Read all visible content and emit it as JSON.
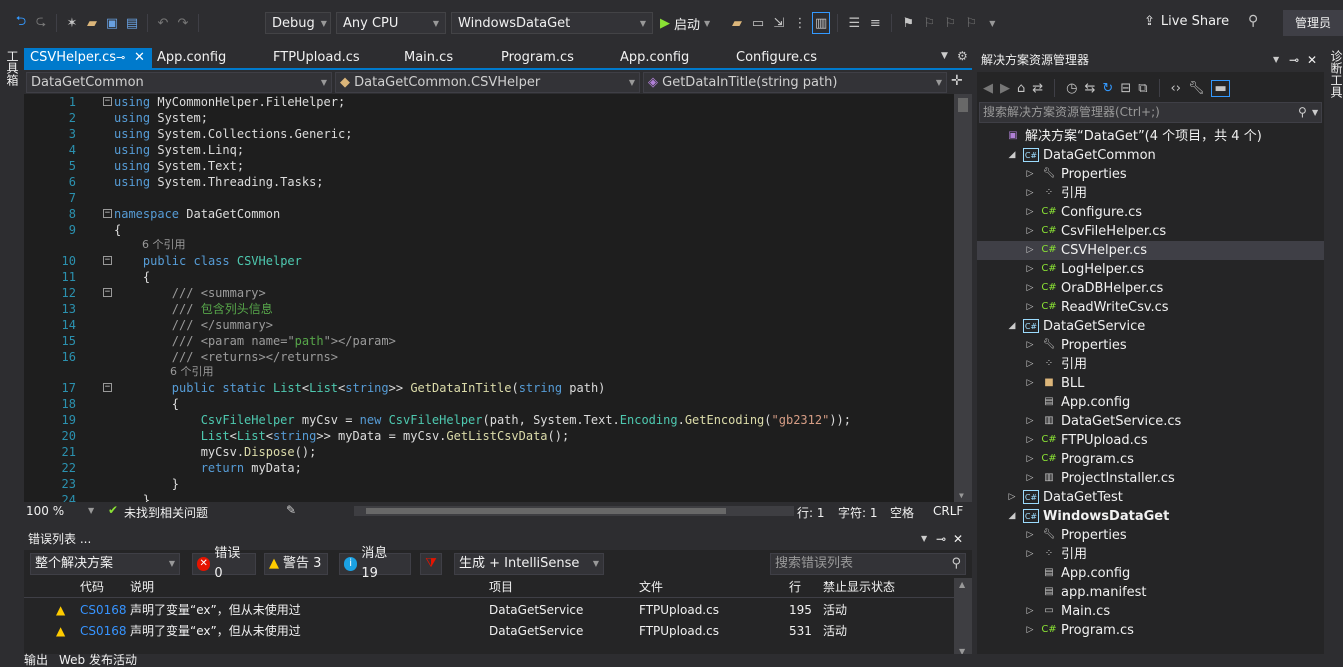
{
  "toolbar": {
    "config": "Debug",
    "platform": "Any CPU",
    "startup_project": "WindowsDataGet",
    "start_label": "启动",
    "live_share": "Live Share",
    "admin": "管理员"
  },
  "left_strip": {
    "label": "工具箱"
  },
  "right_strip": {
    "label": "诊断工具"
  },
  "doc_tabs": [
    {
      "label": "CSVHelper.cs",
      "active": true
    },
    {
      "label": "App.config"
    },
    {
      "label": "FTPUpload.cs"
    },
    {
      "label": "Main.cs"
    },
    {
      "label": "Program.cs"
    },
    {
      "label": "App.config"
    },
    {
      "label": "Configure.cs"
    }
  ],
  "nav": {
    "project": "DataGetCommon",
    "type": "DataGetCommon.CSVHelper",
    "member": "GetDataInTitle(string path)"
  },
  "code_lines": [
    {
      "n": "1",
      "code": "using MyCommonHelper.FileHelper;"
    },
    {
      "n": "2",
      "code": "using System;"
    },
    {
      "n": "3",
      "code": "using System.Collections.Generic;"
    },
    {
      "n": "4",
      "code": "using System.Linq;"
    },
    {
      "n": "5",
      "code": "using System.Text;"
    },
    {
      "n": "6",
      "code": "using System.Threading.Tasks;"
    },
    {
      "n": "7",
      "code": ""
    },
    {
      "n": "8",
      "code": "namespace DataGetCommon"
    },
    {
      "n": "9",
      "code": "{"
    },
    {
      "n": "10",
      "code": "    public class CSVHelper"
    },
    {
      "n": "11",
      "code": "    {"
    },
    {
      "n": "12",
      "code": "        /// <summary>"
    },
    {
      "n": "13",
      "code": "        /// 包含列头信息"
    },
    {
      "n": "14",
      "code": "        /// </summary>"
    },
    {
      "n": "15",
      "code": "        /// <param name=\"path\"></param>"
    },
    {
      "n": "16",
      "code": "        /// <returns></returns>"
    },
    {
      "n": "17",
      "code": "        public static List<List<string>> GetDataInTitle(string path)"
    },
    {
      "n": "18",
      "code": "        {"
    },
    {
      "n": "19",
      "code": "            CsvFileHelper myCsv = new CsvFileHelper(path, System.Text.Encoding.GetEncoding(\"gb2312\"));"
    },
    {
      "n": "20",
      "code": "            List<List<string>> myData = myCsv.GetListCsvData();"
    },
    {
      "n": "21",
      "code": "            myCsv.Dispose();"
    },
    {
      "n": "22",
      "code": "            return myData;"
    },
    {
      "n": "23",
      "code": "        }"
    },
    {
      "n": "24",
      "code": "    }"
    }
  ],
  "code_hints": [
    "6 个引用",
    "6 个引用"
  ],
  "editor_status": {
    "zoom": "100 %",
    "issues": "未找到相关问题",
    "line": "行: 1",
    "col": "字符: 1",
    "mode": "空格",
    "eol": "CRLF"
  },
  "error_list": {
    "title": "错误列表 ...",
    "scope": "整个解决方案",
    "errors": "错误 0",
    "warnings": "警告 3",
    "messages": "消息 19",
    "build_filter": "生成 + IntelliSense",
    "search_placeholder": "搜索错误列表",
    "columns": [
      "代码",
      "说明",
      "项目",
      "文件",
      "行",
      "禁止显示状态"
    ],
    "rows": [
      {
        "code": "CS0168",
        "desc": "声明了变量“ex”，但从未使用过",
        "project": "DataGetService",
        "file": "FTPUpload.cs",
        "line": "195",
        "state": "活动"
      },
      {
        "code": "CS0168",
        "desc": "声明了变量“ex”，但从未使用过",
        "project": "DataGetService",
        "file": "FTPUpload.cs",
        "line": "531",
        "state": "活动"
      }
    ]
  },
  "solution_explorer": {
    "title": "解决方案资源管理器",
    "search_placeholder": "搜索解决方案资源管理器(Ctrl+;)",
    "items": [
      {
        "label": "解决方案“DataGet”(4 个项目，共 4 个)",
        "icon": "solution-icon",
        "depth": 0,
        "tri": ""
      },
      {
        "label": "DataGetCommon",
        "icon": "csproj-icon",
        "depth": 1,
        "tri": "open"
      },
      {
        "label": "Properties",
        "icon": "wrench-icon",
        "depth": 2,
        "tri": "closed"
      },
      {
        "label": "引用",
        "icon": "references-icon",
        "depth": 2,
        "tri": "closed"
      },
      {
        "label": "Configure.cs",
        "icon": "csharp-file-icon",
        "depth": 2,
        "tri": "closed"
      },
      {
        "label": "CsvFileHelper.cs",
        "icon": "csharp-file-icon",
        "depth": 2,
        "tri": "closed"
      },
      {
        "label": "CSVHelper.cs",
        "icon": "csharp-file-icon",
        "depth": 2,
        "tri": "closed",
        "selected": true
      },
      {
        "label": "LogHelper.cs",
        "icon": "csharp-file-icon",
        "depth": 2,
        "tri": "closed"
      },
      {
        "label": "OraDBHelper.cs",
        "icon": "csharp-file-icon",
        "depth": 2,
        "tri": "closed"
      },
      {
        "label": "ReadWriteCsv.cs",
        "icon": "csharp-file-icon",
        "depth": 2,
        "tri": "closed"
      },
      {
        "label": "DataGetService",
        "icon": "csproj-icon",
        "depth": 1,
        "tri": "open"
      },
      {
        "label": "Properties",
        "icon": "wrench-icon",
        "depth": 2,
        "tri": "closed"
      },
      {
        "label": "引用",
        "icon": "references-icon",
        "depth": 2,
        "tri": "closed"
      },
      {
        "label": "BLL",
        "icon": "folder-icon",
        "depth": 2,
        "tri": "closed"
      },
      {
        "label": "App.config",
        "icon": "config-file-icon",
        "depth": 2,
        "tri": ""
      },
      {
        "label": "DataGetService.cs",
        "icon": "service-file-icon",
        "depth": 2,
        "tri": "closed"
      },
      {
        "label": "FTPUpload.cs",
        "icon": "csharp-file-icon",
        "depth": 2,
        "tri": "closed"
      },
      {
        "label": "Program.cs",
        "icon": "csharp-file-icon",
        "depth": 2,
        "tri": "closed"
      },
      {
        "label": "ProjectInstaller.cs",
        "icon": "service-file-icon",
        "depth": 2,
        "tri": "closed"
      },
      {
        "label": "DataGetTest",
        "icon": "csproj-icon",
        "depth": 1,
        "tri": "closed"
      },
      {
        "label": "WindowsDataGet",
        "icon": "csproj-icon",
        "depth": 1,
        "tri": "open",
        "bold": true
      },
      {
        "label": "Properties",
        "icon": "wrench-icon",
        "depth": 2,
        "tri": "closed"
      },
      {
        "label": "引用",
        "icon": "references-icon",
        "depth": 2,
        "tri": "closed"
      },
      {
        "label": "App.config",
        "icon": "config-file-icon",
        "depth": 2,
        "tri": ""
      },
      {
        "label": "app.manifest",
        "icon": "manifest-file-icon",
        "depth": 2,
        "tri": ""
      },
      {
        "label": "Main.cs",
        "icon": "form-file-icon",
        "depth": 2,
        "tri": "closed"
      },
      {
        "label": "Program.cs",
        "icon": "csharp-file-icon",
        "depth": 2,
        "tri": "closed"
      }
    ]
  },
  "bottom_tabs": [
    "输出",
    "Web 发布活动"
  ],
  "colors": {
    "accent": "#007acc",
    "background": "#2d2d30",
    "editor": "#1e1e1e",
    "keyword": "#569cd6",
    "type": "#4ec9b0",
    "comment": "#57a64a"
  }
}
